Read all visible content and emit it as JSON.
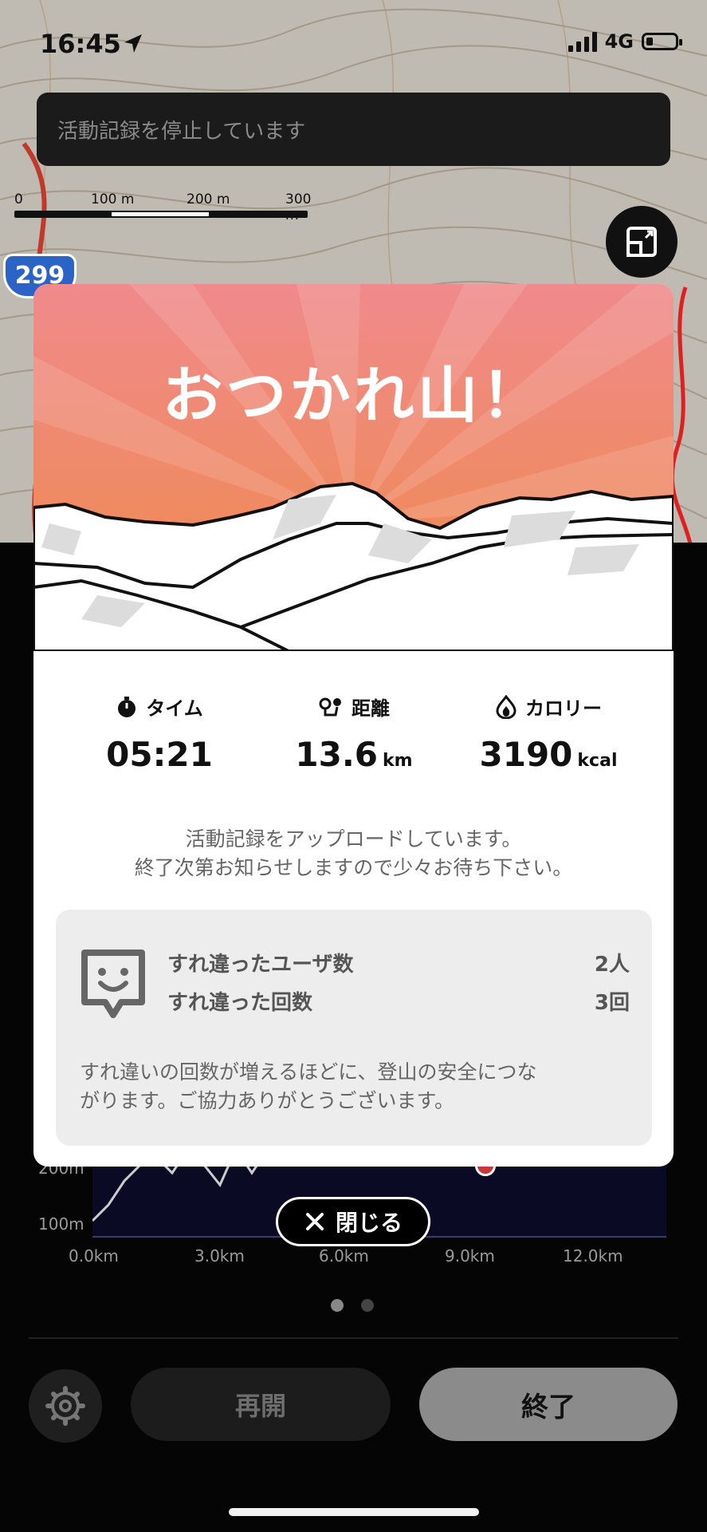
{
  "status": {
    "time": "16:45",
    "network": "4G"
  },
  "map": {
    "banner": "活動記録を停止しています",
    "scale_labels": [
      "0",
      "100 m",
      "200 m",
      "300 m"
    ],
    "route_number": "299"
  },
  "modal": {
    "title": "おつかれ山！",
    "stats": [
      {
        "label": "タイム",
        "value": "05:21",
        "unit": "",
        "icon": "stopwatch-icon"
      },
      {
        "label": "距離",
        "value": "13.6",
        "unit": "km",
        "icon": "route-pin-icon"
      },
      {
        "label": "カロリー",
        "value": "3190",
        "unit": "kcal",
        "icon": "flame-icon"
      }
    ],
    "upload_line1": "活動記録をアップロードしています。",
    "upload_line2": "終了次第お知らせしますので少々お待ち下さい。",
    "passing": {
      "users_label": "すれ違ったユーザ数",
      "users_value": "2人",
      "count_label": "すれ違った回数",
      "count_value": "3回",
      "note_line1": "すれ違いの回数が増えるほどに、登山の安全につな",
      "note_line2": "がります。ご協力ありがとうございます。"
    },
    "hero_colors": {
      "top": "#f0888a",
      "bottom": "#ee8a4a"
    }
  },
  "close_button": "閉じる",
  "chart": {
    "y_labels": [
      "200m",
      "100m"
    ],
    "x_labels": [
      "0.0km",
      "3.0km",
      "6.0km",
      "9.0km",
      "12.0km"
    ]
  },
  "pager": {
    "count": 2,
    "active": 0
  },
  "controls": {
    "resume": "再開",
    "end": "終了"
  },
  "colors": {
    "accent_dark": "#111111",
    "panel": "#050505"
  }
}
